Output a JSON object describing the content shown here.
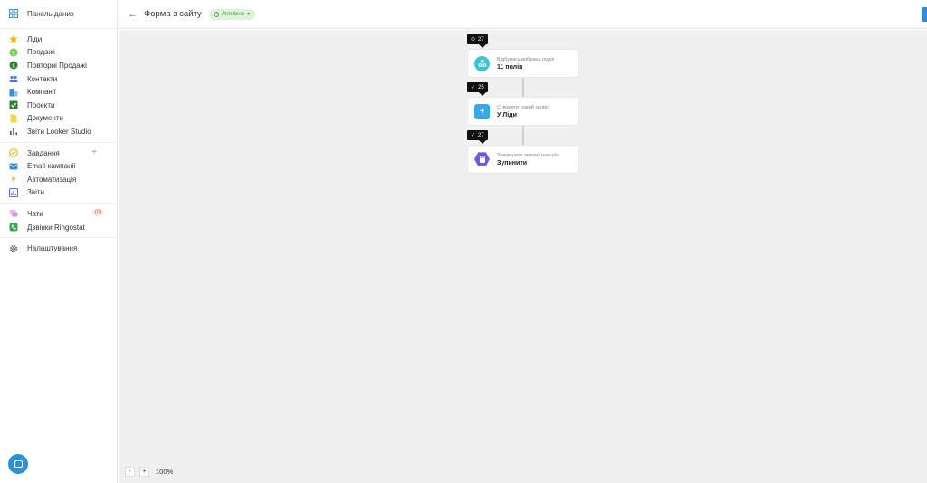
{
  "sidebar": {
    "top": {
      "label": "Панель даних",
      "icon": "dashboard-grid-icon"
    },
    "groups": [
      [
        {
          "label": "Ліди",
          "icon": "star-icon",
          "color": "#f5b400"
        },
        {
          "label": "Продажі",
          "icon": "dollar-circle-icon",
          "color": "#7ac74f"
        },
        {
          "label": "Повторні Продажі",
          "icon": "repeat-dollar-icon",
          "color": "#2e7d32"
        },
        {
          "label": "Контакти",
          "icon": "people-icon",
          "color": "#5b6fd6"
        },
        {
          "label": "Компанії",
          "icon": "building-icon",
          "color": "#3b8ed8"
        },
        {
          "label": "Проєкти",
          "icon": "checkbox-icon",
          "color": "#2e7d32"
        },
        {
          "label": "Документи",
          "icon": "document-icon",
          "color": "#f7d44c"
        },
        {
          "label": "Звіти Looker Studio",
          "icon": "bar-chart-icon",
          "color": "#555555"
        }
      ],
      [
        {
          "label": "Завдання",
          "icon": "check-circle-icon",
          "color": "#f0b429"
        },
        {
          "label": "Email-кампанії",
          "icon": "email-icon",
          "color": "#3b8ed8"
        },
        {
          "label": "Автоматизація",
          "icon": "lightning-icon",
          "color": "#f5a623"
        },
        {
          "label": "Звіти",
          "icon": "report-icon",
          "color": "#5b6fd6"
        }
      ],
      [
        {
          "label": "Чати",
          "icon": "chat-icon",
          "color": "#d39be6",
          "badge": "(0)"
        },
        {
          "label": "Дзвінки Ringostat",
          "icon": "phone-icon",
          "color": "#3aa757"
        }
      ],
      [
        {
          "label": "Налаштування",
          "icon": "gear-icon",
          "color": "#555555"
        }
      ]
    ],
    "add_symbol": "+"
  },
  "header": {
    "back_icon": "arrow-left-icon",
    "title": "Форма з сайту",
    "status": "Активно"
  },
  "flow": {
    "nodes": [
      {
        "counter": "27",
        "counter_icon": "play-icon",
        "subtitle": "Відбулась вибрана подія",
        "title": "11 полів",
        "icon": "webhook-icon"
      },
      {
        "counter": "25",
        "counter_icon": "check-icon",
        "subtitle": "Створити новий запис",
        "title": "У Ліди",
        "icon": "plus-icon"
      },
      {
        "counter": "27",
        "counter_icon": "check-icon",
        "subtitle": "Завершити автоматизацію",
        "title": "Зупинити",
        "icon": "stop-hand-icon"
      }
    ]
  },
  "zoom": {
    "minus": "-",
    "plus": "+",
    "value": "100%"
  }
}
